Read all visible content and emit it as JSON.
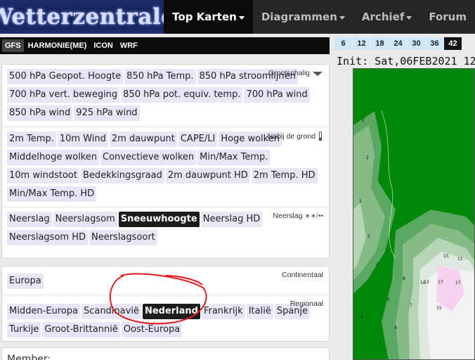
{
  "header": {
    "logo": "Wetterzentrale",
    "nav": [
      {
        "label": "Top Karten",
        "active": true
      },
      {
        "label": "Diagrammen",
        "active": false
      },
      {
        "label": "Archief",
        "active": false
      },
      {
        "label": "Forum",
        "active": false
      }
    ]
  },
  "models": [
    "GFS",
    "HARMONIE(ME)",
    "ICON",
    "WRF"
  ],
  "upper_air": {
    "label": "Grootschalig",
    "items": [
      "500 hPa Geopot. Hoogte",
      "850 hPa Temp.",
      "850 hPa stroomlijnen",
      "700 hPa vert. beweging",
      "850 hPa pot. equiv. temp.",
      "700 hPa wind",
      "850 hPa wind",
      "925 hPa wind"
    ]
  },
  "surface": {
    "label": "Nabij de grond",
    "items": [
      "2m Temp.",
      "10m Wind",
      "2m dauwpunt",
      "CAPE/LI",
      "Hoge wolken",
      "Middelhoge wolken",
      "Convectieve wolken",
      "Min/Max Temp.",
      "10m windstoot",
      "Bedekkingsgraad",
      "2m dauwpunt HD",
      "2m Temp. HD",
      "Min/Max Temp. HD"
    ]
  },
  "precip": {
    "label": "Neerslag",
    "items": [
      "Neerslag",
      "Neerslagsom",
      "Sneeuwhoogte",
      "Neerslag HD",
      "Neerslagsom HD",
      "Neerslagsoort"
    ],
    "selected": "Sneeuwhoogte"
  },
  "continental": {
    "label": "Continentaal",
    "items": [
      "Europa"
    ]
  },
  "regional": {
    "label": "Regionaal",
    "items": [
      "Midden-Europa",
      "Scandinavië",
      "Nederland",
      "Frankrijk",
      "Italië",
      "Spanje",
      "Turkije",
      "Groot-Brittannië",
      "Oost-Europa"
    ],
    "selected": "Nederland"
  },
  "timesteps": {
    "items": [
      "6",
      "12",
      "18",
      "24",
      "30",
      "36",
      "42"
    ],
    "active": "42"
  },
  "init_text": "Init: Sat,06FEB2021 12Z",
  "members_label": "Member:",
  "colors": {
    "header_bg": "#262626",
    "button_bg": "#e6e6f6",
    "selected_bg": "#1c1c1c",
    "timestep_bg": "#cfe8f8",
    "map_green": "#00880a",
    "annotation_red": "#e01b1b"
  }
}
